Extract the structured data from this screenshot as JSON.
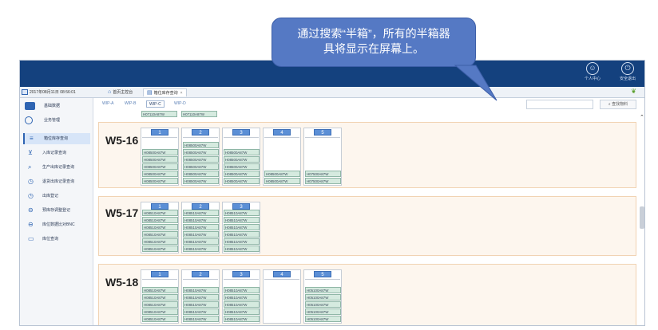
{
  "topbar": {
    "icons": [
      {
        "name": "user-center-icon",
        "label": "个人中心",
        "glyph": "☺"
      },
      {
        "name": "logout-icon",
        "label": "安全退出",
        "glyph": "⏻"
      }
    ]
  },
  "tabbar": {
    "datetime": "2017年08月11日 08:56:01",
    "tabs": [
      {
        "label": "首页主控台",
        "icon": "home-icon"
      },
      {
        "label": "箱位库存查询",
        "icon": "page-icon"
      }
    ],
    "close_glyph": "×"
  },
  "sidebar": {
    "top_items": [
      {
        "label": "基础数据",
        "color": "#2e64b2"
      },
      {
        "label": "业务管理",
        "color": "#2e64b2"
      }
    ],
    "sub_items": [
      {
        "label": "箱位库存查询",
        "glyph": "≡",
        "active": true
      },
      {
        "label": "入库记录查询",
        "glyph": "⊻",
        "active": false
      },
      {
        "label": "生产出库记录查询",
        "glyph": "⌕",
        "active": false
      },
      {
        "label": "退货出库记录查询",
        "glyph": "◷",
        "active": false
      },
      {
        "label": "出库登记",
        "glyph": "◷",
        "active": false
      },
      {
        "label": "预库存调整登记",
        "glyph": "⊖",
        "active": false
      },
      {
        "label": "库位数据比对BNC",
        "glyph": "⊖",
        "active": false
      },
      {
        "label": "库位查询",
        "glyph": "▭",
        "active": false
      }
    ]
  },
  "content": {
    "subtabs": [
      "WIP-A",
      "WIP-B",
      "WIP-C",
      "WIP-D"
    ],
    "active_subtab": 2,
    "search_button_label": "查找物料",
    "search_value": "",
    "partial_labels": [
      "H07110A87W",
      "H07110A87W"
    ],
    "sections": [
      {
        "title": "W5-16",
        "boxes": [
          {
            "num": "1",
            "labels": [
              "H08500A87W",
              "H08500A87W",
              "H08500A87W",
              "H08500A87W",
              "H08500A87W"
            ]
          },
          {
            "num": "2",
            "labels": [
              "H08500A87W",
              "H08500A87W",
              "H08500A87W",
              "H08500A87W",
              "H08500A87W",
              "H08500A87W"
            ]
          },
          {
            "num": "3",
            "labels": [
              "H08500A87W",
              "H08500A87W",
              "H08500A87W",
              "H08500A87W",
              "H08500A87W"
            ]
          },
          {
            "num": "4",
            "labels": [
              "H08500A87W",
              "H08500A87W"
            ]
          },
          {
            "num": "5",
            "labels": [
              "H07500A87W",
              "H07500A87W"
            ]
          }
        ]
      },
      {
        "title": "W5-17",
        "boxes": [
          {
            "num": "1",
            "labels": [
              "H08510A87W",
              "H08510A87W",
              "H08510A87W",
              "H08510A87W",
              "H08510A87W",
              "H08510A87W"
            ]
          },
          {
            "num": "2",
            "labels": [
              "H08510A87W",
              "H08510A87W",
              "H08510A87W",
              "H08510A87W",
              "H08510A87W",
              "H08510A87W"
            ]
          },
          {
            "num": "3",
            "labels": [
              "H08510A87W",
              "H08510A87W",
              "H08510A87W",
              "H08510A87W",
              "H08510A87W",
              "H08510A87W"
            ]
          }
        ]
      },
      {
        "title": "W5-18",
        "boxes": [
          {
            "num": "1",
            "labels": [
              "H08510A87W",
              "H08510A87W",
              "H08510A87W",
              "H08510A87W",
              "H08510A87W"
            ]
          },
          {
            "num": "2",
            "labels": [
              "H08510A87W",
              "H08510A87W",
              "H08510A87W",
              "H08510A87W",
              "H08510A87W"
            ]
          },
          {
            "num": "3",
            "labels": [
              "H08510A87W",
              "H08510A87W",
              "H08510A87W",
              "H08510A87W",
              "H08510A87W"
            ]
          },
          {
            "num": "4",
            "labels": []
          },
          {
            "num": "5",
            "labels": [
              "H05100A87W",
              "H05100A87W",
              "H05100A87W",
              "H05100A87W",
              "H05100A87W"
            ]
          }
        ]
      }
    ]
  },
  "callout": {
    "line1": "通过搜索“半箱”，所有的半箱器",
    "line2": "具将显示在屏幕上。"
  },
  "colors": {
    "topbar": "#14417e",
    "callout": "#5579c4",
    "label_fill": "#d5eadf",
    "box_header": "#5b8fd6"
  }
}
